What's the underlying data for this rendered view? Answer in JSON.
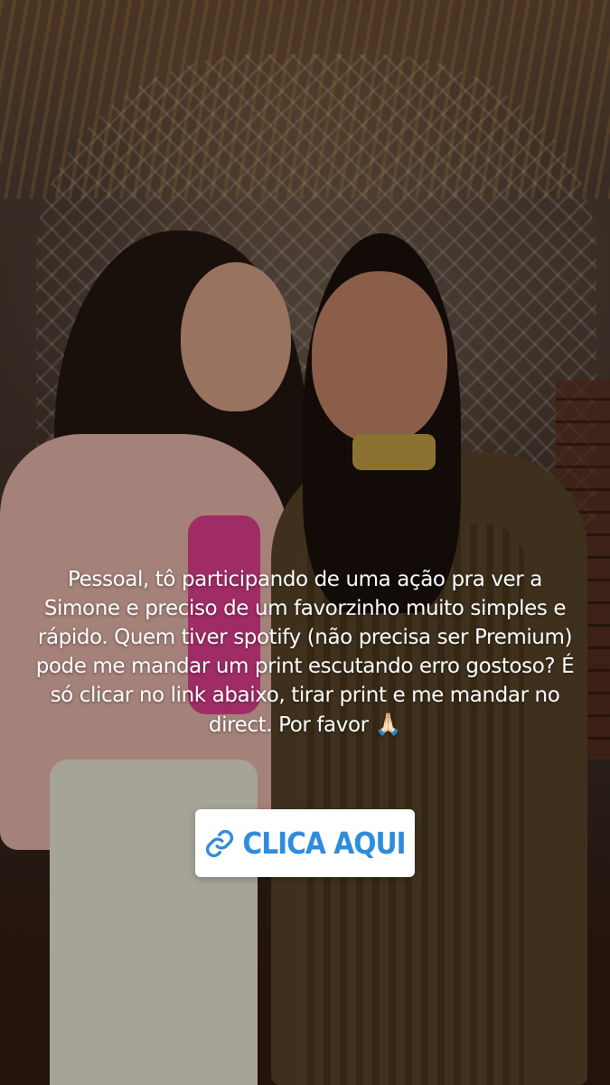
{
  "story": {
    "caption": "Pessoal, tô participando de uma ação pra ver a Simone e preciso de um favorzinho muito simples e rápido. Quem tiver spotify (não precisa ser Premium) pode me mandar um print escutando erro gostoso? É só clicar no link abaixo, tirar print e me mandar no direct. Por favor",
    "caption_emoji": "🙏🏻",
    "link_sticker": {
      "label": "CLICA AQUI",
      "icon": "link-icon",
      "text_color": "#2f8cdc",
      "background": "#ffffff"
    }
  }
}
